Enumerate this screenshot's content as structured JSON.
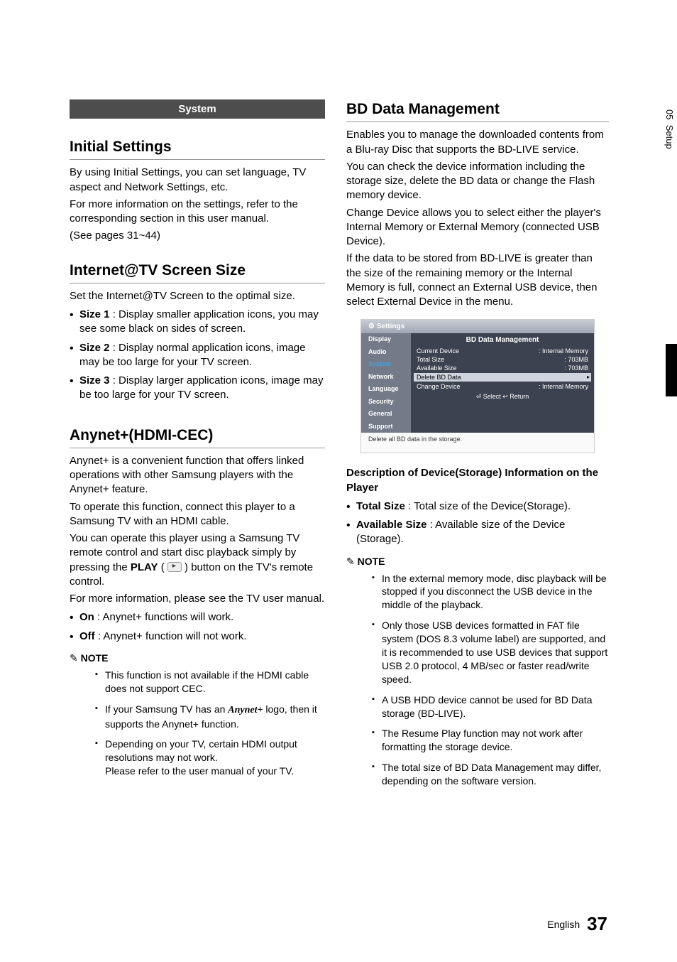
{
  "sidebar": {
    "chapter": "05",
    "section": "Setup"
  },
  "left": {
    "banner": "System",
    "initial": {
      "title": "Initial Settings",
      "p1": "By using Initial Settings, you can set language, TV aspect and Network Settings, etc.",
      "p2": "For more information on the settings, refer to the corresponding section in this user manual.",
      "p3": "(See pages 31~44)"
    },
    "itv": {
      "title": "Internet@TV Screen Size",
      "intro": "Set the Internet@TV Screen to the optimal size.",
      "items": [
        {
          "label": "Size 1",
          "text": " : Display smaller application icons, you may see some black on sides of screen."
        },
        {
          "label": "Size 2",
          "text": " : Display normal application icons, image may be too large for your TV screen."
        },
        {
          "label": "Size 3",
          "text": " : Display larger application icons, image may be too large for your TV screen."
        }
      ]
    },
    "anynet": {
      "title": "Anynet+(HDMI-CEC)",
      "p1": "Anynet+ is a convenient function that offers linked operations with other Samsung players with the Anynet+ feature.",
      "p2": "To operate this function, connect this player to a Samsung TV with an HDMI cable.",
      "p3a": "You can operate this player using a Samsung TV remote control and start disc playback simply by pressing the ",
      "play": "PLAY",
      "p3b": " ) button on the TV's remote control.",
      "p4": "For more information, please see the TV user manual.",
      "items": [
        {
          "label": "On",
          "text": " : Anynet+ functions will work."
        },
        {
          "label": "Off",
          "text": " : Anynet+ function will not work."
        }
      ],
      "note_label": "NOTE",
      "notes": [
        "This function is not available if the HDMI cable does not support CEC.",
        "__ANYNET__",
        "Depending on your TV, certain HDMI output resolutions may not work.\nPlease refer to the user manual of your TV."
      ],
      "note_anynet_a": "If your Samsung TV has an ",
      "note_anynet_logo": "Anynet+",
      "note_anynet_b": " logo, then it supports the Anynet+ function."
    }
  },
  "right": {
    "bd": {
      "title": "BD Data Management",
      "p1": "Enables you to manage the downloaded contents from a Blu-ray Disc that supports the BD-LIVE service.",
      "p2": "You can check the device information including the storage size, delete the BD data or change the Flash memory device.",
      "p3": "Change Device allows you to select either the player's Internal Memory or External Memory (connected USB Device).",
      "p4": "If the data to be stored from BD-LIVE is greater than the size of the remaining memory or the Internal Memory is full, connect an External USB device, then select External Device in the menu."
    },
    "settings_ui": {
      "title": "Settings",
      "panel_title": "BD Data Management",
      "nav": [
        "Display",
        "Audio",
        "System",
        "Network",
        "Language",
        "Security",
        "General",
        "Support"
      ],
      "rows": {
        "current": {
          "label": "Current Device",
          "value": ": Internal Memory"
        },
        "total": {
          "label": "Total Size",
          "value": ": 703MB"
        },
        "avail": {
          "label": "Available Size",
          "value": ": 703MB"
        },
        "delete": {
          "label": "Delete BD Data",
          "value": ""
        },
        "change": {
          "label": "Change Device",
          "value": ": Internal Memory"
        }
      },
      "btns": "⏎ Select    ↩ Return",
      "caption": "Delete all BD data in the storage."
    },
    "desc": {
      "head": "Description of Device(Storage) Information on the Player",
      "items": [
        {
          "label": "Total Size",
          "text": " : Total size of the Device(Storage)."
        },
        {
          "label": "Available Size",
          "text": " : Available size of the Device (Storage)."
        }
      ],
      "note_label": "NOTE",
      "notes": [
        "In the external memory mode, disc playback will be stopped if you disconnect the USB device in the middle of the playback.",
        "Only those USB devices formatted in FAT file system (DOS 8.3 volume label) are supported, and it is recommended to use USB devices that support USB 2.0 protocol, 4 MB/sec or faster read/write speed.",
        "A USB HDD device cannot be used for BD Data storage (BD-LIVE).",
        "The Resume Play function may not work after formatting the storage device.",
        "The total size of BD Data Management may differ, depending on the software version."
      ]
    }
  },
  "footer": {
    "lang": "English",
    "page": "37"
  }
}
